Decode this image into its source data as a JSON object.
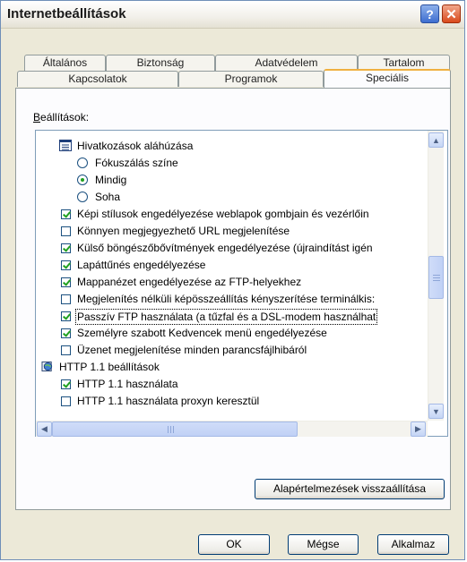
{
  "window": {
    "title": "Internetbeállítások"
  },
  "titlebar_buttons": {
    "help": "?",
    "close": "✕"
  },
  "tabs_row1": [
    "Általános",
    "Biztonság",
    "Adatvédelem",
    "Tartalom"
  ],
  "tabs_row2": [
    "Kapcsolatok",
    "Programok",
    "Speciális"
  ],
  "selected_tab": "Speciális",
  "settings_label": "Beállítások:",
  "settings_items": [
    {
      "type": "group",
      "icon": "list-icon",
      "label": "Hivatkozások aláhúzása"
    },
    {
      "type": "radio",
      "checked": false,
      "label": "Fókuszálás színe"
    },
    {
      "type": "radio",
      "checked": true,
      "label": "Mindig"
    },
    {
      "type": "radio",
      "checked": false,
      "label": "Soha"
    },
    {
      "type": "checkbox",
      "checked": true,
      "label": "Képi stílusok engedélyezése weblapok gombjain és vezérlőin"
    },
    {
      "type": "checkbox",
      "checked": false,
      "label": "Könnyen megjegyezhető URL megjelenítése"
    },
    {
      "type": "checkbox",
      "checked": true,
      "label": "Külső böngészőbővítmények engedélyezése (újraindítást igén"
    },
    {
      "type": "checkbox",
      "checked": true,
      "label": "Lapáttűnés engedélyezése"
    },
    {
      "type": "checkbox",
      "checked": true,
      "label": "Mappanézet engedélyezése az FTP-helyekhez"
    },
    {
      "type": "checkbox",
      "checked": false,
      "label": "Megjelenítés nélküli képösszeállítás kényszerítése terminálkis:"
    },
    {
      "type": "checkbox",
      "checked": true,
      "label": "Passzív FTP használata (a tűzfal és a DSL-modem használhat"
    },
    {
      "type": "checkbox",
      "checked": true,
      "label": "Személyre szabott Kedvencek menü engedélyezése"
    },
    {
      "type": "checkbox",
      "checked": false,
      "label": "Üzenet megjelenítése minden parancsfájlhibáról"
    },
    {
      "type": "group",
      "icon": "globe-icon",
      "label": "HTTP 1.1 beállítások"
    },
    {
      "type": "checkbox",
      "checked": true,
      "label": "HTTP 1.1 használata"
    },
    {
      "type": "checkbox",
      "checked": false,
      "label": "HTTP 1.1 használata proxyn keresztül"
    }
  ],
  "focused_item": "Passzív FTP használata (a tűzfal és a DSL-modem használhat",
  "restore_button": "Alapértelmezések visszaállítása",
  "footer_buttons": {
    "ok": "OK",
    "cancel": "Mégse",
    "apply": "Alkalmaz"
  },
  "colors": {
    "selected_tab_accent": "#f0b040",
    "check_green": "#21a121",
    "titlebar_close": "#d94a1c"
  }
}
